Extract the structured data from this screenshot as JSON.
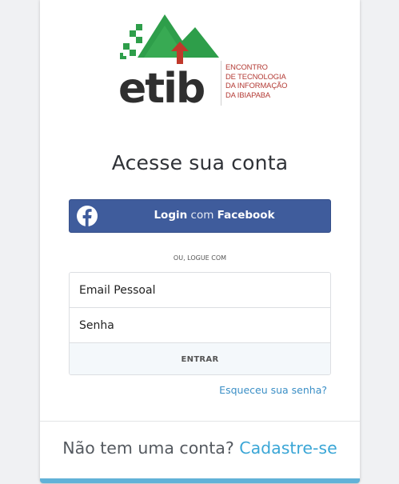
{
  "logo": {
    "wordmark": "etib",
    "tagline_lines": [
      "ENCONTRO",
      "DE TECNOLOGIA",
      "DA INFORMAÇÃO",
      "DA IBIAPABA"
    ],
    "colors": {
      "green": "#2e9e4a",
      "dark": "#2f2f2f",
      "red": "#c0392b"
    }
  },
  "title": "Acesse sua conta",
  "facebook": {
    "login_word": "Login",
    "com_word": "com",
    "brand_word": "Facebook",
    "icon": "facebook-icon",
    "color": "#3f5c9c"
  },
  "divider_text": "OU, LOGUE COM",
  "form": {
    "email_placeholder": "Email Pessoal",
    "password_placeholder": "Senha",
    "submit_label": "ENTRAR"
  },
  "forgot_password": "Esqueceu sua senha?",
  "signup": {
    "prompt": "Não tem uma conta?",
    "link": "Cadastre-se"
  },
  "accent_color": "#61b2d8"
}
